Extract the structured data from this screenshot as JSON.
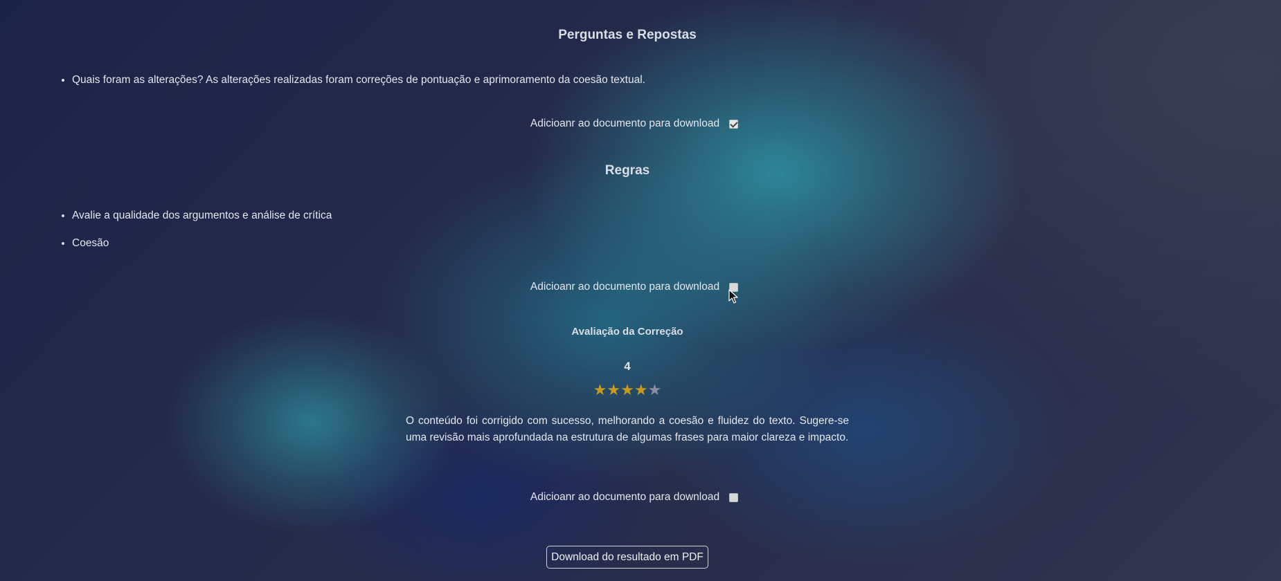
{
  "qa_section": {
    "title": "Perguntas e Repostas",
    "items": [
      {
        "text": "Quais foram as alterações? As alterações realizadas foram correções de pontuação e aprimoramento da coesão textual."
      }
    ],
    "download_label": "Adicioanr ao documento para download",
    "download_checked": true
  },
  "rules_section": {
    "title": "Regras",
    "items": [
      {
        "text": "Avalie a qualidade dos argumentos e análise de crítica"
      },
      {
        "text": "Coesão"
      }
    ],
    "download_label": "Adicioanr ao documento para download",
    "download_checked": false
  },
  "evaluation_section": {
    "title": "Avaliação da Correção",
    "score": "4",
    "stars_filled": 4,
    "stars_total": 5,
    "star_color": "#c99a1e",
    "feedback": "O conteúdo foi corrigido com sucesso, melhorando a coesão e fluidez do texto. Sugere-se uma revisão mais aprofundada na estrutura de algumas frases para maior clareza e impacto.",
    "download_label": "Adicioanr ao documento para download",
    "download_checked": false
  },
  "pdf_button": {
    "label": "Download do resultado em PDF"
  }
}
